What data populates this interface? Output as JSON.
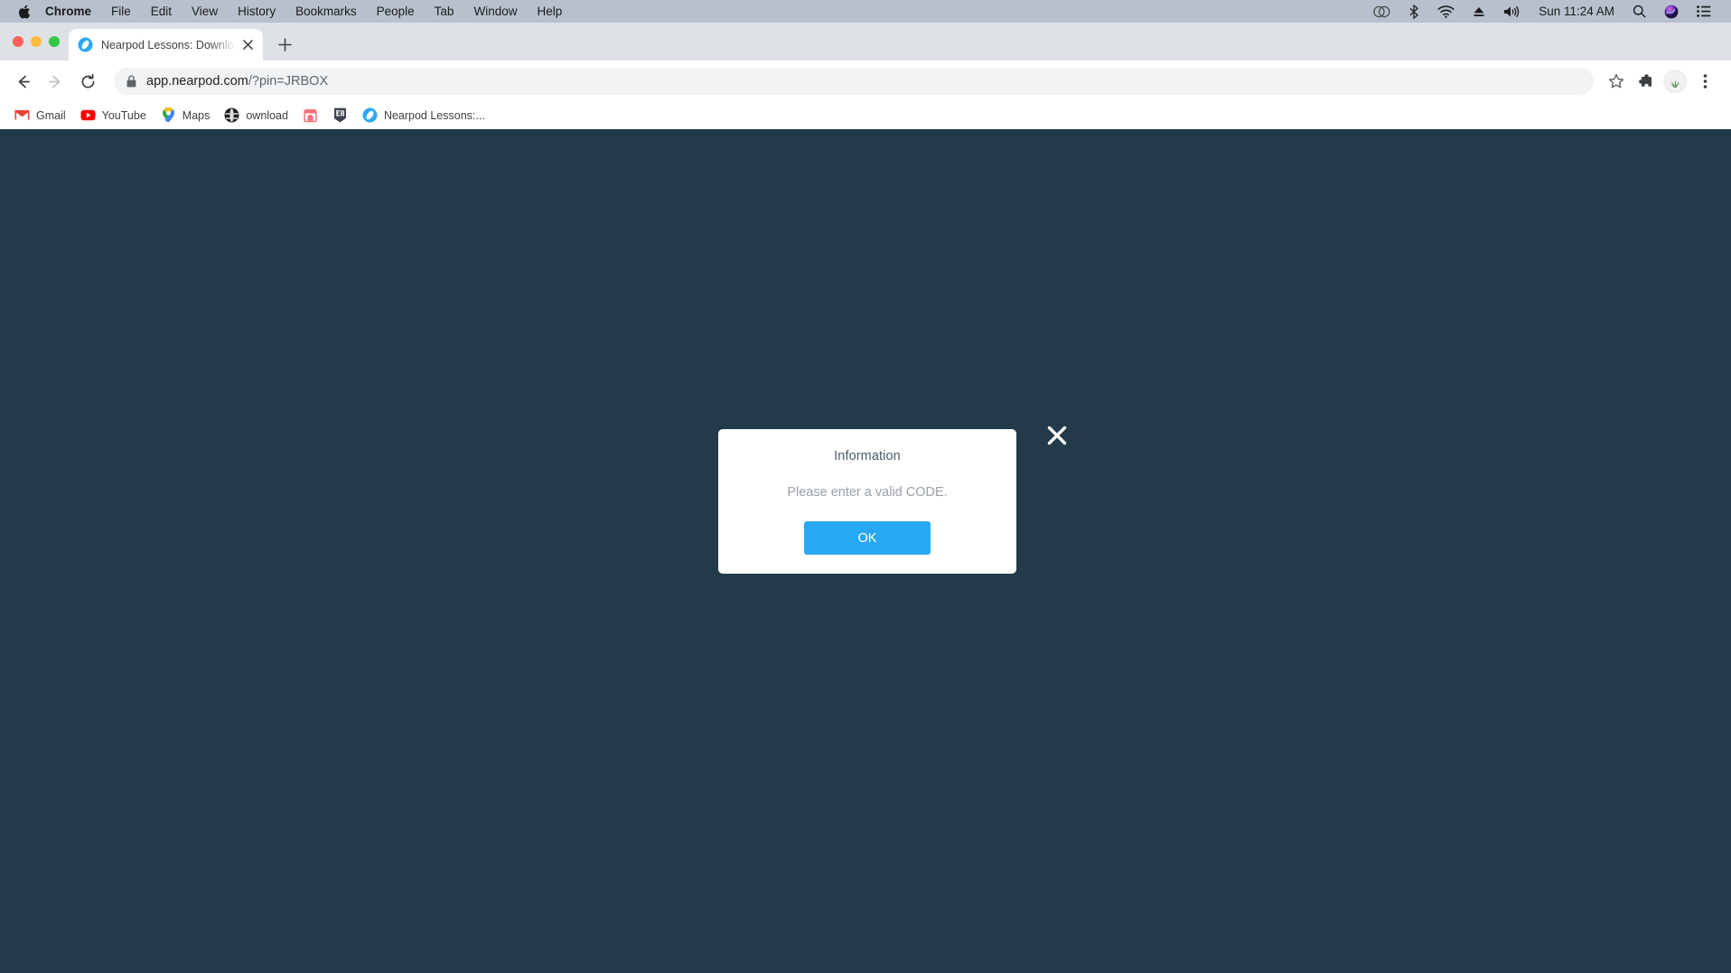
{
  "menubar": {
    "apple_icon": "apple-logo-icon",
    "items": [
      {
        "label": "Chrome",
        "bold": true
      },
      {
        "label": "File",
        "bold": false
      },
      {
        "label": "Edit",
        "bold": false
      },
      {
        "label": "View",
        "bold": false
      },
      {
        "label": "History",
        "bold": false
      },
      {
        "label": "Bookmarks",
        "bold": false
      },
      {
        "label": "People",
        "bold": false
      },
      {
        "label": "Tab",
        "bold": false
      },
      {
        "label": "Window",
        "bold": false
      },
      {
        "label": "Help",
        "bold": false
      }
    ],
    "status_icons": [
      "creative-cloud-icon",
      "bluetooth-icon",
      "wifi-icon",
      "eject-icon",
      "volume-icon"
    ],
    "clock": "Sun 11:24 AM",
    "trailing_icons": [
      "spotlight-search-icon",
      "siri-icon",
      "control-center-icon"
    ]
  },
  "window_controls": {
    "close_color": "#FC6058",
    "minimize_color": "#FDBC40",
    "zoom_color": "#34C749"
  },
  "tabstrip": {
    "tab": {
      "favicon": "nearpod-favicon",
      "title": "Nearpod Lessons: Download re",
      "close_icon": "close-icon"
    },
    "new_tab_label": "+"
  },
  "toolbar": {
    "back_icon": "back-arrow-icon",
    "forward_icon": "forward-arrow-icon",
    "reload_icon": "reload-icon",
    "omnibox": {
      "lock_icon": "lock-icon",
      "host": "app.nearpod.com",
      "path": "/?pin=JRBOX"
    },
    "bookmark_star_icon": "star-icon",
    "extensions_icon": "puzzle-piece-icon",
    "profile_icon": "profile-avatar",
    "menu_icon": "three-dot-menu-icon"
  },
  "bookmarks": [
    {
      "icon": "gmail-icon",
      "label": "Gmail"
    },
    {
      "icon": "youtube-icon",
      "label": "YouTube"
    },
    {
      "icon": "maps-pin-icon",
      "label": "Maps"
    },
    {
      "icon": "globe-icon",
      "label": "ownload"
    },
    {
      "icon": "store-icon",
      "label": ""
    },
    {
      "icon": "epic-badge-icon",
      "label": ""
    },
    {
      "icon": "nearpod-favicon",
      "label": "Nearpod Lessons:..."
    }
  ],
  "page": {
    "background_color": "#233A48"
  },
  "dialog": {
    "title": "Information",
    "message": "Please enter a valid CODE.",
    "ok_label": "OK",
    "ok_color": "#29A8F5",
    "close_icon": "close-icon"
  }
}
